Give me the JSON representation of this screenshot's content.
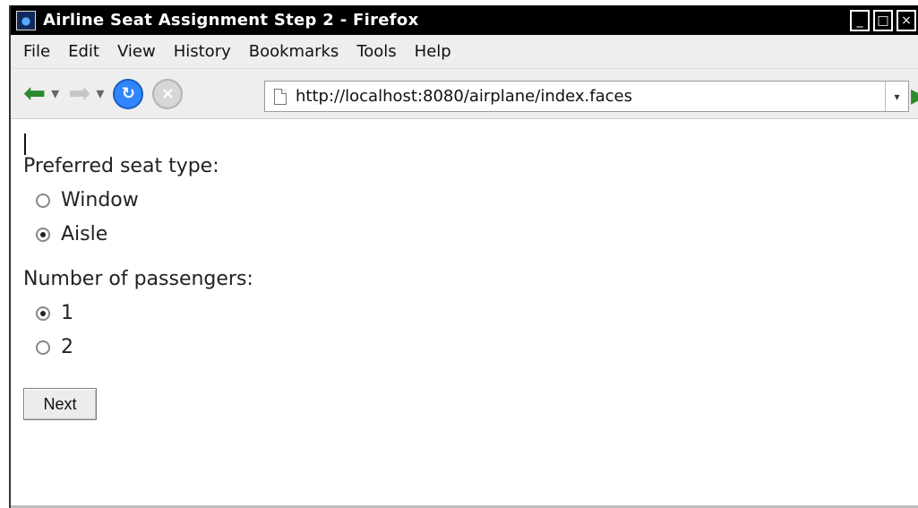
{
  "window": {
    "title": "Airline Seat Assignment Step 2 - Firefox",
    "controls": {
      "minimize": "_",
      "maximize": "□",
      "close": "×"
    }
  },
  "menu": {
    "items": [
      "File",
      "Edit",
      "View",
      "History",
      "Bookmarks",
      "Tools",
      "Help"
    ]
  },
  "nav": {
    "url": "http://localhost:8080/airplane/index.faces",
    "dropdown_symbol": "▾"
  },
  "form": {
    "seat_type_label": "Preferred seat type:",
    "seat_options": [
      {
        "label": "Window",
        "checked": false
      },
      {
        "label": "Aisle",
        "checked": true
      }
    ],
    "passengers_label": "Number of passengers:",
    "passenger_options": [
      {
        "label": "1",
        "checked": true
      },
      {
        "label": "2",
        "checked": false
      }
    ],
    "next_label": "Next"
  }
}
